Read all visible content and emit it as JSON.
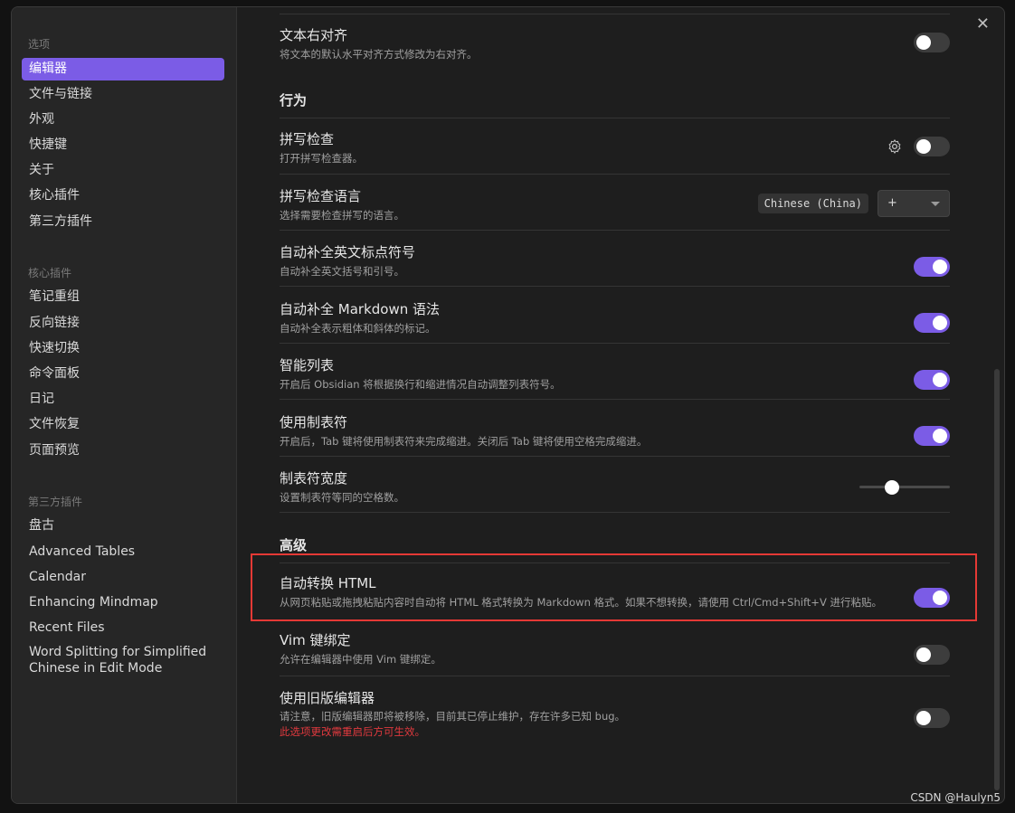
{
  "sidebar": {
    "options_heading": "选项",
    "options_items": [
      {
        "label": "编辑器",
        "active": true
      },
      {
        "label": "文件与链接"
      },
      {
        "label": "外观"
      },
      {
        "label": "快捷键"
      },
      {
        "label": "关于"
      },
      {
        "label": "核心插件"
      },
      {
        "label": "第三方插件"
      }
    ],
    "core_heading": "核心插件",
    "core_items": [
      {
        "label": "笔记重组"
      },
      {
        "label": "反向链接"
      },
      {
        "label": "快速切换"
      },
      {
        "label": "命令面板"
      },
      {
        "label": "日记"
      },
      {
        "label": "文件恢复"
      },
      {
        "label": "页面预览"
      }
    ],
    "third_heading": "第三方插件",
    "third_items": [
      {
        "label": "盘古"
      },
      {
        "label": "Advanced Tables"
      },
      {
        "label": "Calendar"
      },
      {
        "label": "Enhancing Mindmap"
      },
      {
        "label": "Recent Files"
      },
      {
        "label": "Word Splitting for Simplified Chinese in Edit Mode"
      }
    ]
  },
  "close_label": "✕",
  "settings": {
    "right_align": {
      "title": "文本右对齐",
      "desc": "将文本的默认水平对齐方式修改为右对齐。",
      "enabled": false
    },
    "behavior_heading": "行为",
    "spellcheck": {
      "title": "拼写检查",
      "desc": "打开拼写检查器。",
      "enabled": false
    },
    "spellcheck_lang": {
      "title": "拼写检查语言",
      "desc": "选择需要检查拼写的语言。",
      "selected": "Chinese (China)",
      "select_value": "+"
    },
    "auto_pair_brackets": {
      "title": "自动补全英文标点符号",
      "desc": "自动补全英文括号和引号。",
      "enabled": true
    },
    "auto_pair_markdown": {
      "title": "自动补全 Markdown 语法",
      "desc": "自动补全表示粗体和斜体的标记。",
      "enabled": true
    },
    "smart_lists": {
      "title": "智能列表",
      "desc": "开启后 Obsidian 将根据换行和缩进情况自动调整列表符号。",
      "enabled": true
    },
    "use_tabs": {
      "title": "使用制表符",
      "desc": "开启后，Tab 键将使用制表符来完成缩进。关闭后 Tab 键将使用空格完成缩进。",
      "enabled": true
    },
    "tab_size": {
      "title": "制表符宽度",
      "desc": "设置制表符等同的空格数。",
      "slider_fraction": 0.36
    },
    "advanced_heading": "高级",
    "auto_convert_html": {
      "title": "自动转换 HTML",
      "desc": "从网页粘贴或拖拽粘贴内容时自动将 HTML 格式转换为 Markdown 格式。如果不想转换，请使用 Ctrl/Cmd+Shift+V 进行粘贴。",
      "enabled": true
    },
    "vim_keys": {
      "title": "Vim 键绑定",
      "desc": "允许在编辑器中使用 Vim 键绑定。",
      "enabled": false
    },
    "legacy_editor": {
      "title": "使用旧版编辑器",
      "desc": "请注意，旧版编辑器即将被移除，目前其已停止维护，存在许多已知 bug。",
      "warning": "此选项更改需重启后方可生效。",
      "enabled": false
    }
  },
  "watermark": "CSDN @Haulyn5",
  "colors": {
    "accent": "#7b5ce6",
    "highlight_border": "#e53935",
    "warning": "#e0393e"
  }
}
